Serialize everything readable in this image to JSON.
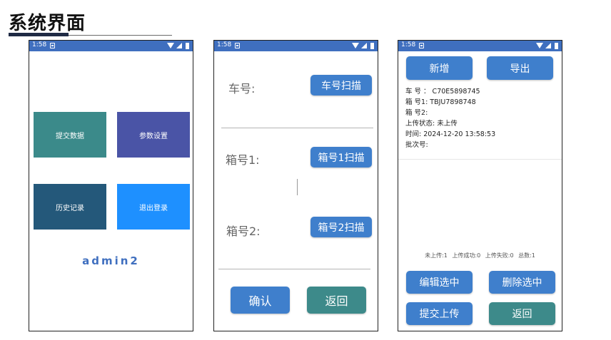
{
  "page": {
    "title": "系统界面"
  },
  "status_bar": {
    "time": "1:58"
  },
  "screen1": {
    "tiles": [
      {
        "label": "提交数据",
        "color": "#3b8a8a"
      },
      {
        "label": "参数设置",
        "color": "#4a54a6"
      },
      {
        "label": "历史记录",
        "color": "#24587a"
      },
      {
        "label": "退出登录",
        "color": "#1e90ff"
      }
    ],
    "username": "admin2"
  },
  "screen2": {
    "car_label": "车号:",
    "car_scan": "车号扫描",
    "box1_label": "箱号1:",
    "box1_scan": "箱号1扫描",
    "box2_label": "箱号2:",
    "box2_scan": "箱号2扫描",
    "confirm": "确认",
    "back": "返回"
  },
  "screen3": {
    "add": "新增",
    "export": "导出",
    "record": {
      "car": "车 号 ： C70E5898745",
      "box1": "箱 号1:   TBJU7898748",
      "box2": "箱 号2:",
      "status": "上传状态: 未上传",
      "time": "时间: 2024-12-20 13:58:53",
      "batch": "批次号:"
    },
    "stats": {
      "not_uploaded": "未上传:1",
      "success": "上传成功:0",
      "failed": "上传失败:0",
      "total": "总数:1"
    },
    "edit_selected": "编辑选中",
    "delete_selected": "删除选中",
    "submit_upload": "提交上传",
    "back": "返回"
  }
}
